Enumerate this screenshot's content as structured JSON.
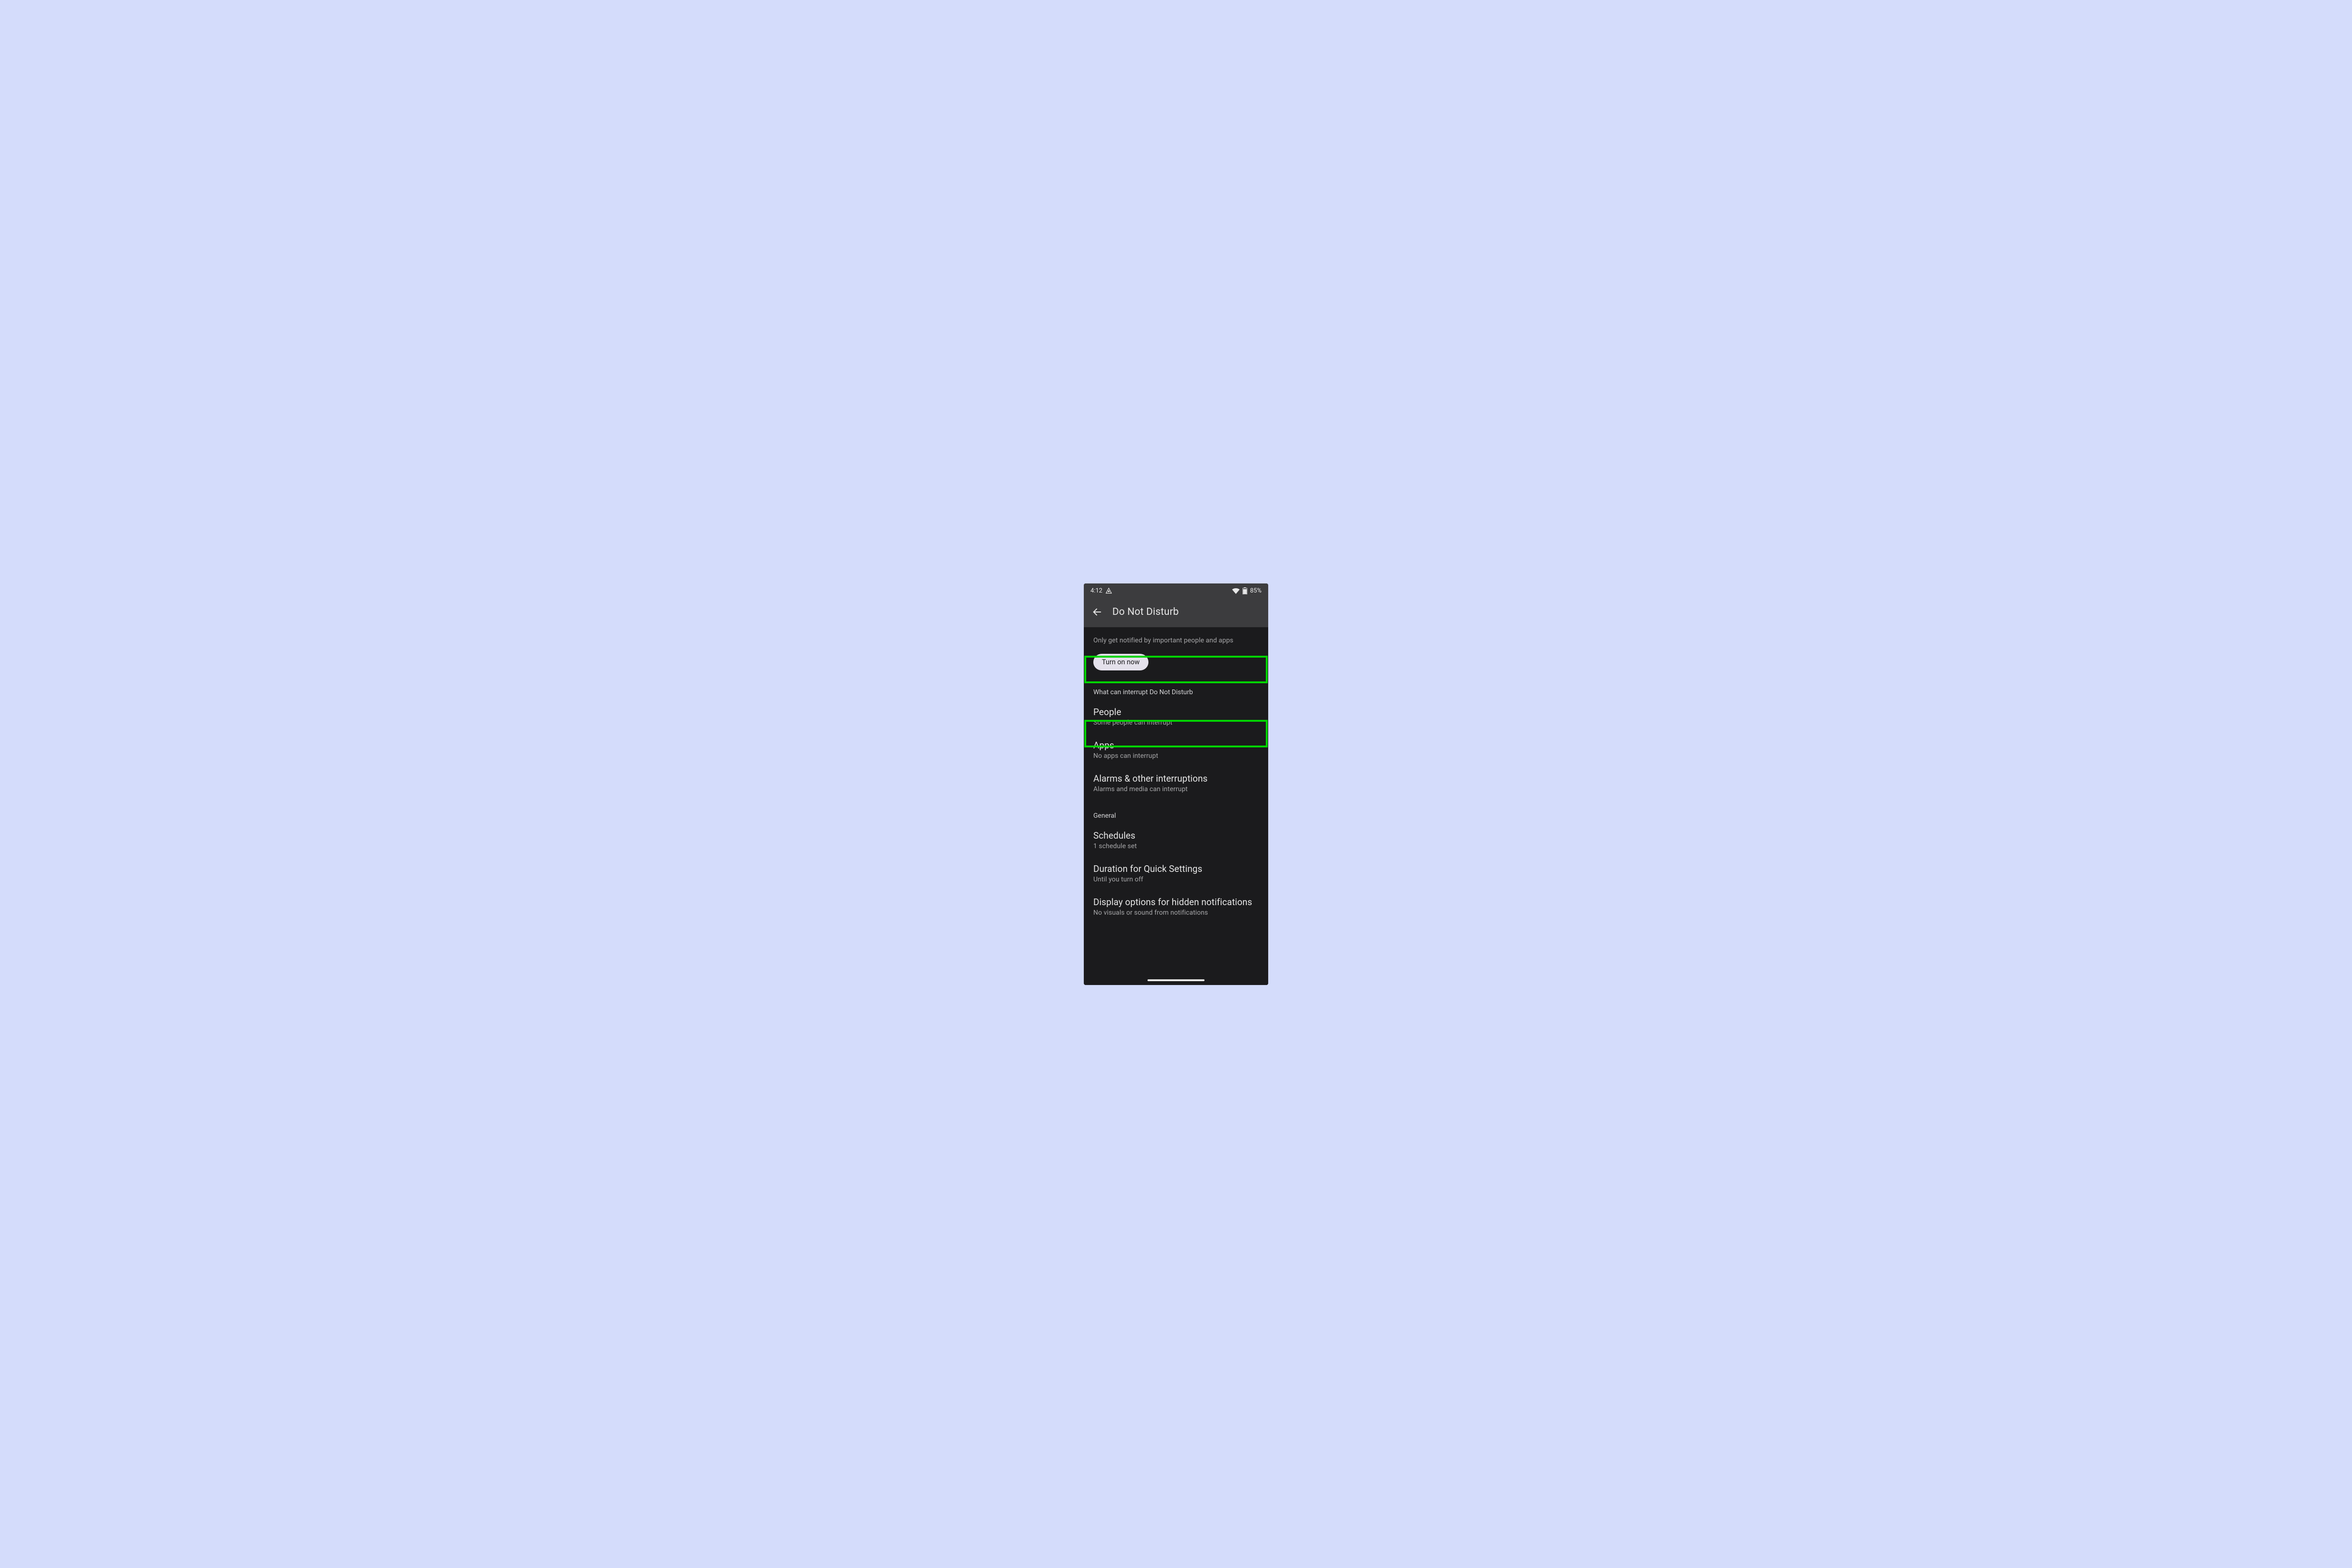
{
  "status": {
    "time": "4:12",
    "battery_text": "85%"
  },
  "header": {
    "title": "Do Not Disturb"
  },
  "subtitle": "Only get notified by important people and apps",
  "toggle_label": "Turn on now",
  "sections": {
    "interrupt": {
      "header": "What can interrupt Do Not Disturb",
      "people": {
        "title": "People",
        "sub": "Some people can interrupt"
      },
      "apps": {
        "title": "Apps",
        "sub": "No apps can interrupt"
      },
      "alarms": {
        "title": "Alarms & other interruptions",
        "sub": "Alarms and media can interrupt"
      }
    },
    "general": {
      "header": "General",
      "schedules": {
        "title": "Schedules",
        "sub": "1 schedule set"
      },
      "duration": {
        "title": "Duration for Quick Settings",
        "sub": "Until you turn off"
      },
      "display": {
        "title": "Display options for hidden notifications",
        "sub": "No visuals or sound from notifications"
      }
    }
  }
}
